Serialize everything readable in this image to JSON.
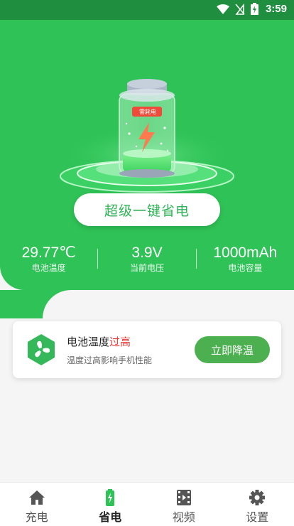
{
  "status_bar": {
    "time": "3:59",
    "icons": [
      "wifi-icon",
      "signal-off-icon",
      "battery-charging-icon"
    ]
  },
  "main": {
    "action_button": "超级一键省电",
    "battery_badge": "需耗电",
    "stats": [
      {
        "value": "29.77℃",
        "label": "电池温度"
      },
      {
        "value": "3.9V",
        "label": "当前电压"
      },
      {
        "value": "1000mAh",
        "label": "电池容量"
      }
    ]
  },
  "card": {
    "icon": "fan-icon",
    "title": "电池温度",
    "title_warn": "过高",
    "subtitle": "温度过高影响手机性能",
    "button": "立即降温"
  },
  "bottom_nav": [
    {
      "label": "充电",
      "icon": "home-icon"
    },
    {
      "label": "省电",
      "icon": "battery-icon",
      "active": true
    },
    {
      "label": "视频",
      "icon": "video-icon"
    },
    {
      "label": "设置",
      "icon": "gear-icon"
    }
  ],
  "colors": {
    "primary_green": "#2fc357",
    "status_green": "#1f8f3f",
    "warn_red": "#e53935",
    "button_green": "#4caf50"
  }
}
